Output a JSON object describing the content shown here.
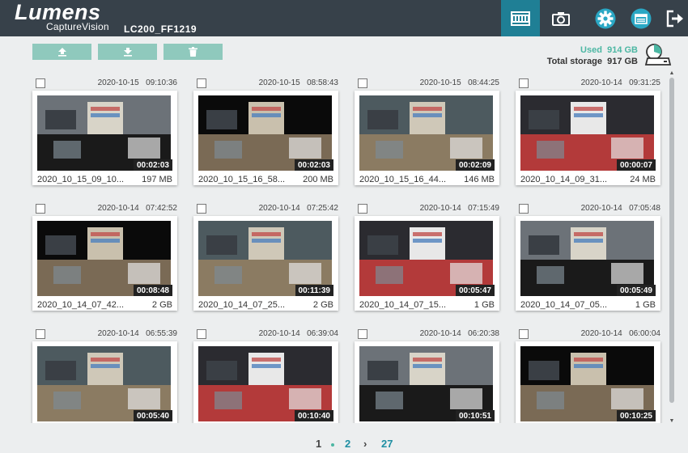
{
  "header": {
    "logo": "Lumens",
    "logo_sub": "CaptureVision",
    "device_name": "LC200_FF1219",
    "nav": [
      {
        "name": "recordings-icon",
        "active": true
      },
      {
        "name": "camera-icon",
        "active": false
      },
      {
        "name": "settings-gear-icon",
        "active": false
      },
      {
        "name": "media-files-icon",
        "active": false
      },
      {
        "name": "logout-icon",
        "active": false
      }
    ]
  },
  "toolbar": {
    "buttons": [
      "upload-icon",
      "download-icon",
      "delete-icon"
    ]
  },
  "storage": {
    "used_label": "Used",
    "used_value": "914 GB",
    "total_label": "Total storage",
    "total_value": "917 GB"
  },
  "recordings": [
    {
      "date": "2020-10-15   09:10:36",
      "duration": "00:02:03",
      "name": "2020_10_15_09_10...",
      "size": "197 MB"
    },
    {
      "date": "2020-10-15   08:58:43",
      "duration": "00:02:03",
      "name": "2020_10_15_16_58...",
      "size": "200 MB"
    },
    {
      "date": "2020-10-15   08:44:25",
      "duration": "00:02:09",
      "name": "2020_10_15_16_44...",
      "size": "146 MB"
    },
    {
      "date": "2020-10-14   09:31:25",
      "duration": "00:00:07",
      "name": "2020_10_14_09_31...",
      "size": "24 MB"
    },
    {
      "date": "2020-10-14   07:42:52",
      "duration": "00:08:48",
      "name": "2020_10_14_07_42...",
      "size": "2 GB"
    },
    {
      "date": "2020-10-14   07:25:42",
      "duration": "00:11:39",
      "name": "2020_10_14_07_25...",
      "size": "2 GB"
    },
    {
      "date": "2020-10-14   07:15:49",
      "duration": "00:05:47",
      "name": "2020_10_14_07_15...",
      "size": "1 GB"
    },
    {
      "date": "2020-10-14   07:05:48",
      "duration": "00:05:49",
      "name": "2020_10_14_07_05...",
      "size": "1 GB"
    },
    {
      "date": "2020-10-14   06:55:39",
      "duration": "00:05:40",
      "name": "",
      "size": ""
    },
    {
      "date": "2020-10-14   06:39:04",
      "duration": "00:10:40",
      "name": "",
      "size": ""
    },
    {
      "date": "2020-10-14   06:20:38",
      "duration": "00:10:51",
      "name": "",
      "size": ""
    },
    {
      "date": "2020-10-14   06:00:04",
      "duration": "00:10:25",
      "name": "",
      "size": ""
    }
  ],
  "pagination": {
    "current": "1",
    "next": "2",
    "last": "27"
  },
  "colors": {
    "header_bg": "#37414a",
    "active_tab": "#1f7f95",
    "accent": "#4cb7a3",
    "button": "#8fc9bd",
    "gear": "#2aa7c4"
  }
}
